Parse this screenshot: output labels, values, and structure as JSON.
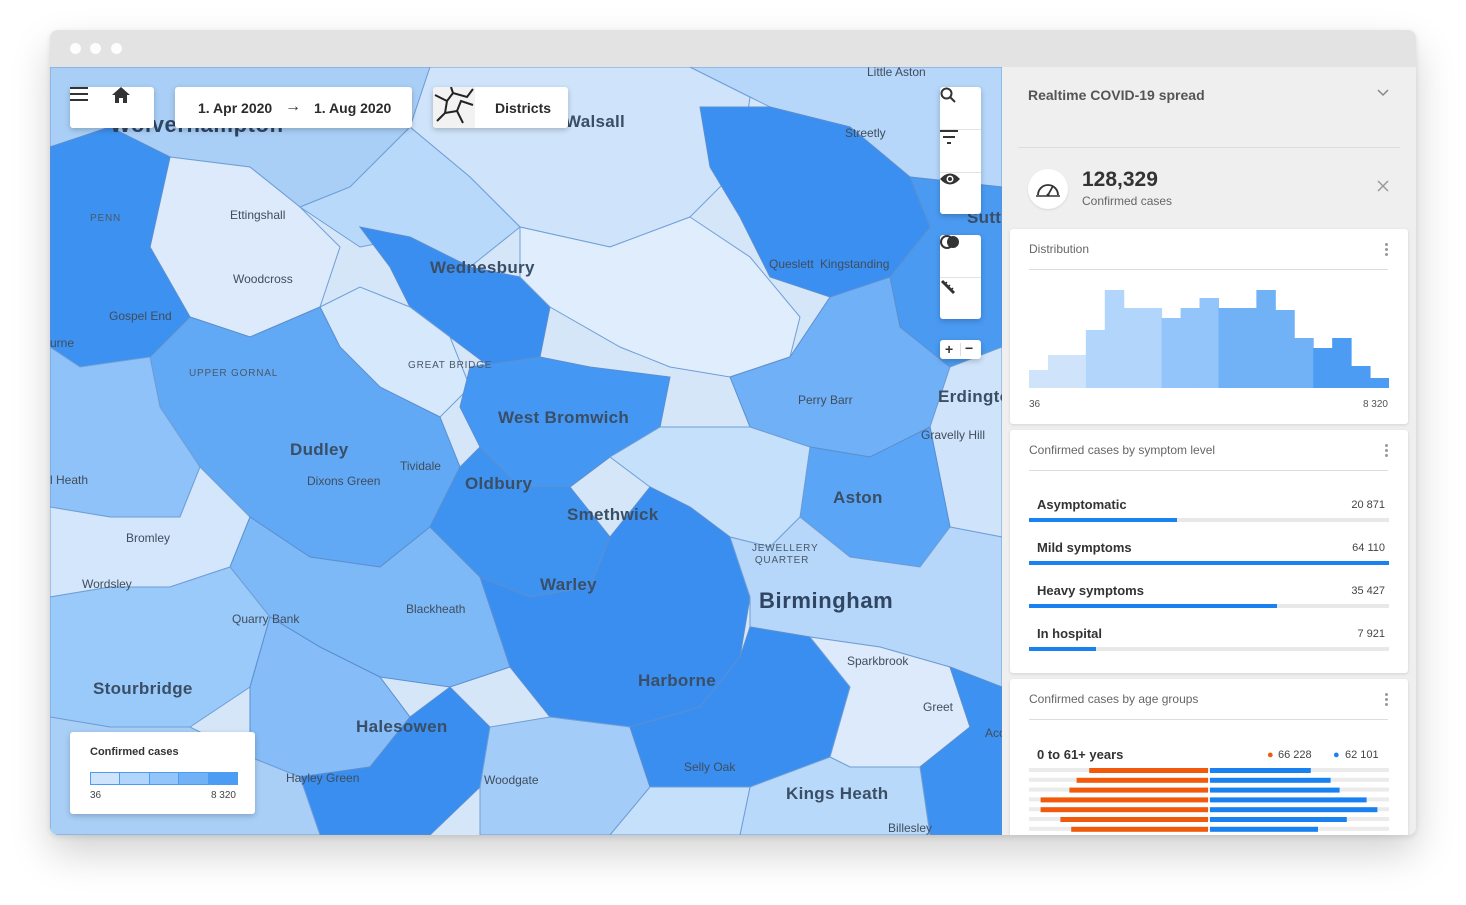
{
  "window": {
    "controls": [
      "close",
      "minimize",
      "zoom"
    ]
  },
  "toolbar": {
    "menu_icon": "menu-icon",
    "home_icon": "home-icon",
    "date_from": "1. Apr 2020",
    "date_arrow": "→",
    "date_to": "1. Aug 2020",
    "layer_label": "Districts"
  },
  "map_tools": {
    "search_icon": "search-icon",
    "filter_icon": "filter-icon",
    "eye_icon": "eye-icon",
    "toggle_icon": "toggle-icon",
    "ruler_icon": "ruler-icon",
    "zoom_in": "+",
    "zoom_out": "−"
  },
  "map_labels": {
    "wolverhampton": "Wolverhampton",
    "walsall": "Walsall",
    "little_aston": "Little Aston",
    "streetly": "Streetly",
    "sutton": "Sutt",
    "penn": "PENN",
    "ettingshall": "Ettingshall",
    "woodcross": "Woodcross",
    "gospel_end": "Gospel End",
    "wednesbury": "Wednesbury",
    "queslett": "Queslett",
    "kingstanding": "Kingstanding",
    "great_bridge": "GREAT BRIDGE",
    "upper_gornal": "UPPER GORNAL",
    "west_bromwich": "West Bromwich",
    "perry_barr": "Perry Barr",
    "erdington": "Erdingto",
    "gravelly_hill": "Gravelly Hill",
    "dudley": "Dudley",
    "tividale": "Tividale",
    "dixons_green": "Dixons Green",
    "oldbury": "Oldbury",
    "aston": "Aston",
    "smethwick": "Smethwick",
    "heath": "l Heath",
    "bromley": "Bromley",
    "jewellery_quarter": "JEWELLERY QUARTER",
    "wordsley": "Wordsley",
    "warley": "Warley",
    "birmingham": "Birmingham",
    "blackheath": "Blackheath",
    "quarry_bank": "Quarry Bank",
    "sparkbrook": "Sparkbrook",
    "stourbridge": "Stourbridge",
    "harborne": "Harborne",
    "greet": "Greet",
    "halesowen": "Halesowen",
    "acocks": "Aco",
    "hayley_green": "Hayley Green",
    "woodgate": "Woodgate",
    "selly_oak": "Selly Oak",
    "kings_heath": "Kings Heath",
    "billesley": "Billesley",
    "urne": "urne"
  },
  "legend": {
    "title": "Confirmed cases",
    "min": "36",
    "max": "8 320",
    "colors": [
      "#cfe4fb",
      "#b2d5fb",
      "#93c4fa",
      "#71b2f7",
      "#4c9cf4"
    ]
  },
  "panel": {
    "title": "Realtime COVID-19 spread",
    "chevron_icon": "chevron-down-icon",
    "gauge_icon": "gauge-icon",
    "close_icon": "close-icon",
    "kpi_value": "128,329",
    "kpi_label": "Confirmed cases",
    "distribution": {
      "title": "Distribution",
      "min": "36",
      "max": "8 320"
    },
    "symptoms": {
      "title": "Confirmed cases by symptom level",
      "rows": [
        {
          "label": "Asymptomatic",
          "value": "20 871",
          "fraction": 0.41
        },
        {
          "label": "Mild symptoms",
          "value": "64 110",
          "fraction": 1.0
        },
        {
          "label": "Heavy symptoms",
          "value": "35 427",
          "fraction": 0.69
        },
        {
          "label": "In hospital",
          "value": "7 921",
          "fraction": 0.185
        }
      ]
    },
    "age": {
      "title": "Confirmed cases by age groups",
      "range_label": "0 to 61+ years",
      "orange_value": "66 228",
      "blue_value": "62 101",
      "orange_color": "#f05a0a",
      "blue_color": "#1a82f0"
    }
  },
  "chart_data": {
    "type": "bar",
    "title": "Distribution",
    "xlim": [
      36,
      8320
    ],
    "values": [
      0.18,
      0.33,
      0.33,
      0.58,
      0.98,
      0.8,
      0.8,
      0.7,
      0.8,
      0.9,
      0.8,
      0.8,
      0.98,
      0.78,
      0.5,
      0.4,
      0.5,
      0.22,
      0.1
    ],
    "age_groups": {
      "orange": [
        0.66,
        0.73,
        0.77,
        0.93,
        0.93,
        0.82,
        0.76,
        0.67
      ],
      "blue": [
        0.56,
        0.67,
        0.72,
        0.87,
        0.93,
        0.76,
        0.6,
        0.51
      ]
    }
  }
}
